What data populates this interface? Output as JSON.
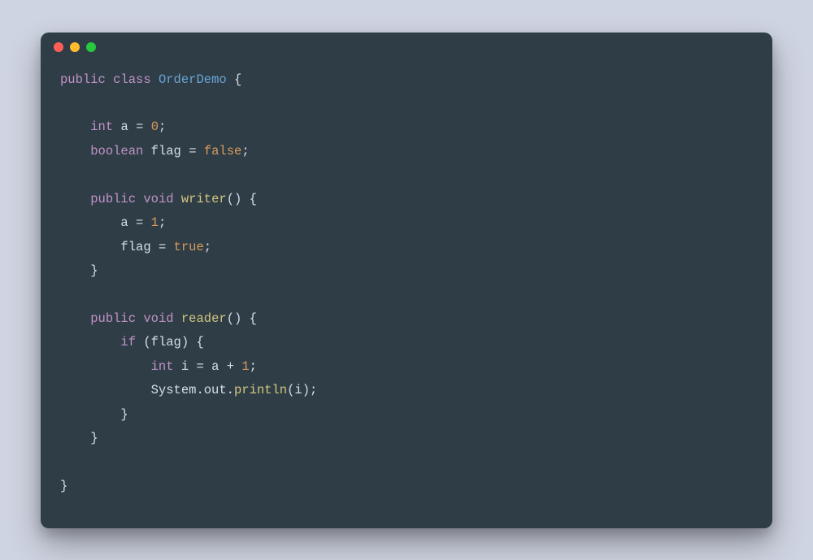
{
  "colors": {
    "page_bg": "#cfd4e2",
    "window_bg": "#2f3e46",
    "dot_red": "#ff5f56",
    "dot_yellow": "#ffbd2e",
    "dot_green": "#27c93f",
    "kw": "#c191c8",
    "type": "#6aa3d4",
    "fn": "#d3c580",
    "num": "#d99a5e",
    "bool": "#d99a5e",
    "text": "#d8dee9"
  },
  "code": {
    "language": "java",
    "class_name": "OrderDemo",
    "field1_type": "int",
    "field1_name": "a",
    "field1_value": "0",
    "field2_type": "boolean",
    "field2_name": "flag",
    "field2_value": "false",
    "method1_name": "writer",
    "method1_body_assign1_lhs": "a",
    "method1_body_assign1_rhs": "1",
    "method1_body_assign2_lhs": "flag",
    "method1_body_assign2_rhs": "true",
    "method2_name": "reader",
    "method2_if_cond": "flag",
    "method2_decl_type": "int",
    "method2_decl_name": "i",
    "method2_decl_expr_lhs": "a",
    "method2_decl_expr_rhs": "1",
    "method2_call_chain1": "System",
    "method2_call_chain2": "out",
    "method2_call_fn": "println",
    "method2_call_arg": "i",
    "kw_public": "public",
    "kw_class": "class",
    "kw_void": "void",
    "kw_if": "if",
    "kw_int": "int",
    "kw_boolean": "boolean",
    "sym_lbrace": "{",
    "sym_rbrace": "}",
    "sym_lparen_rparen": "()",
    "sym_lparen": "(",
    "sym_rparen": ")",
    "sym_semi": ";",
    "sym_eq": "=",
    "sym_plus": "+",
    "sym_dot": "."
  }
}
